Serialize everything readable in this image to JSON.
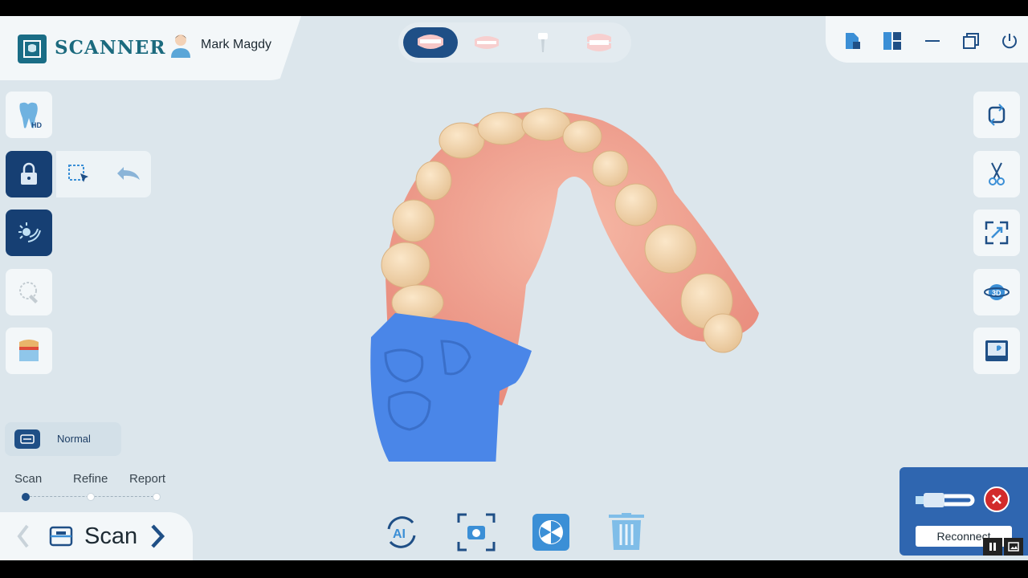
{
  "app": {
    "logo_text": "SCANNER",
    "user_name": "Mark Magdy"
  },
  "modes": [
    {
      "icon": "upper-jaw-icon",
      "active": true
    },
    {
      "icon": "lower-jaw-icon",
      "active": false
    },
    {
      "icon": "implant-icon",
      "active": false
    },
    {
      "icon": "bite-icon",
      "active": false
    }
  ],
  "window_controls": [
    "document-icon",
    "layout-icon",
    "minimize-icon",
    "restore-icon",
    "power-icon"
  ],
  "left_tools": [
    "hd-tooth-icon",
    "lock-icon",
    "light-icon",
    "scanbody-icon",
    "shade-icon"
  ],
  "subtools": [
    "select-region-icon",
    "undo-icon"
  ],
  "right_tools": [
    "rotate-view-icon",
    "scissors-icon",
    "fit-view-icon",
    "3d-view-icon",
    "monitor-icon"
  ],
  "mode_selector": {
    "label": "Normal"
  },
  "workflow": {
    "steps": [
      "Scan",
      "Refine",
      "Report"
    ],
    "active_step": 0
  },
  "bottom_nav": {
    "title": "Scan"
  },
  "bottom_tools": [
    "ai-scan-icon",
    "capture-icon",
    "color-wheel-icon",
    "trash-icon"
  ],
  "device": {
    "reconnect_label": "Reconnect"
  },
  "colors": {
    "accent": "#1f4f86",
    "background": "#dce6ec",
    "scan_highlight": "#4a86e8",
    "error": "#d22b2b"
  }
}
